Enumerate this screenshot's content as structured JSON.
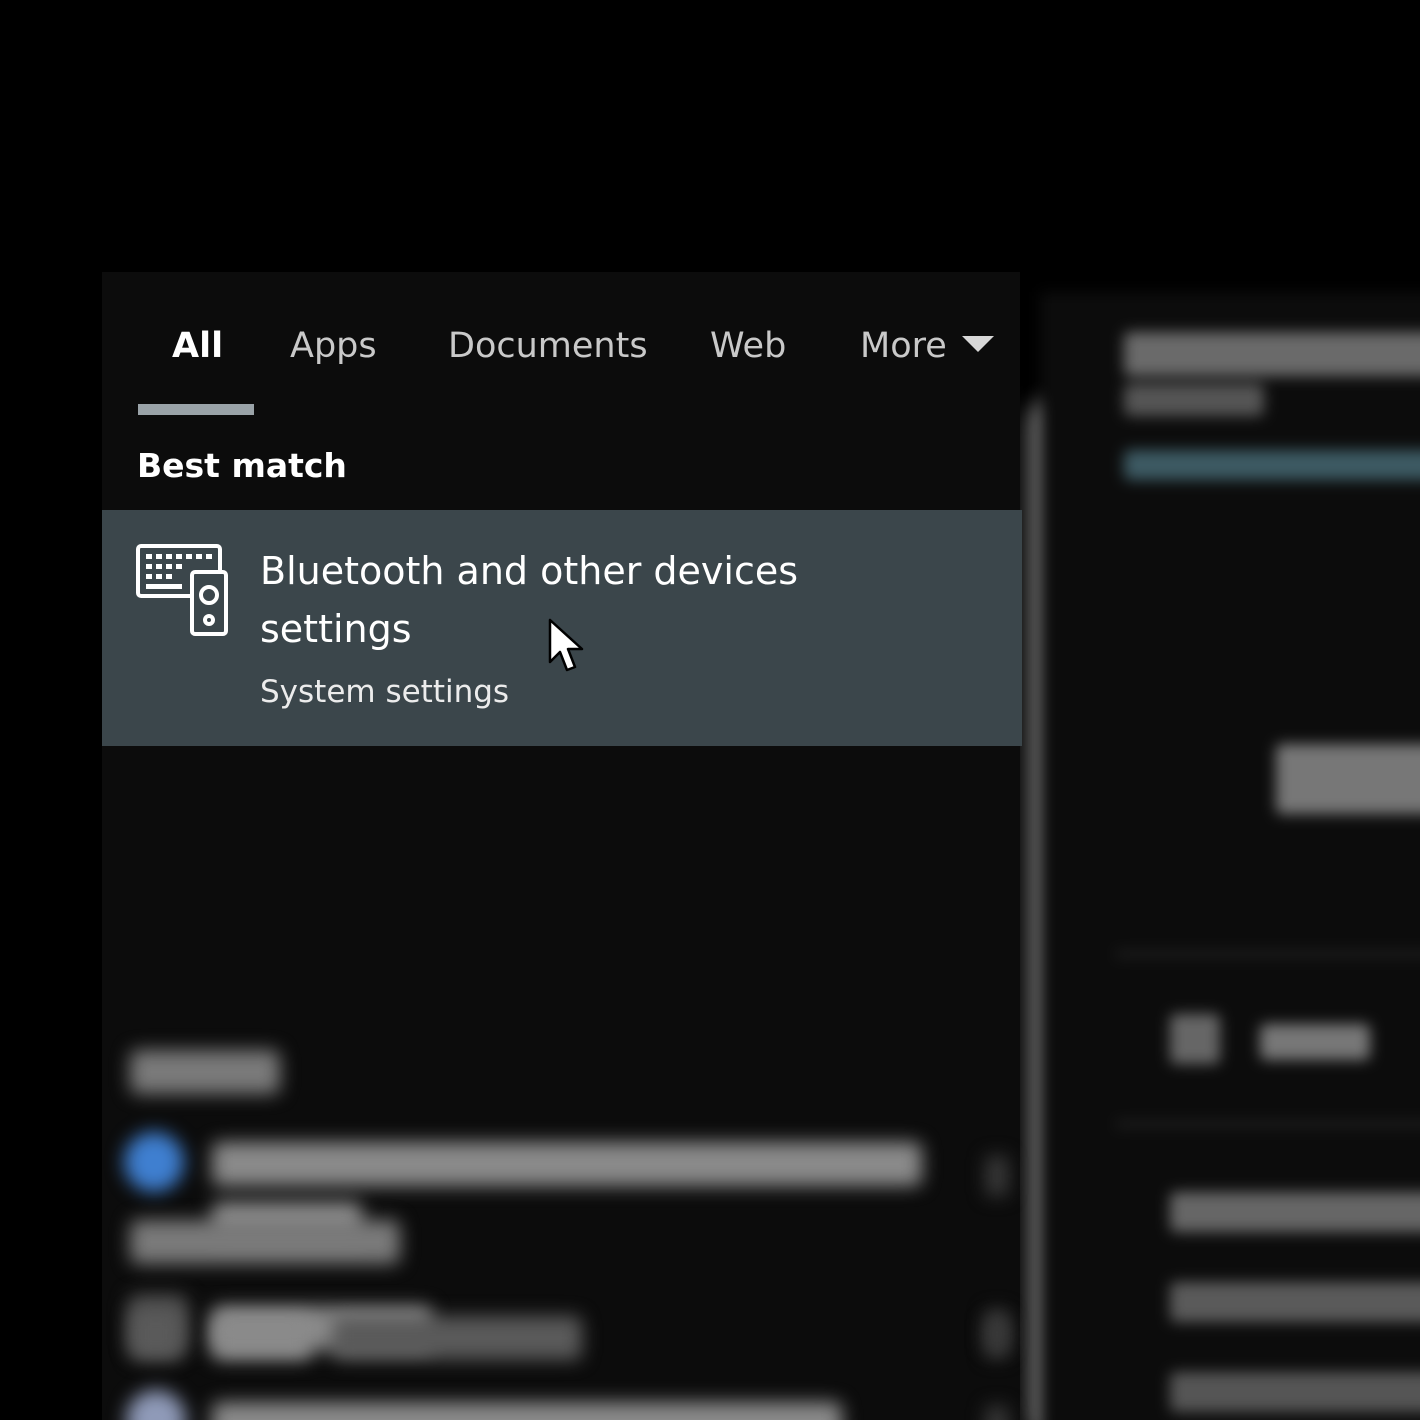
{
  "search_panel": {
    "tabs": [
      {
        "label": "All",
        "active": true
      },
      {
        "label": "Apps",
        "active": false
      },
      {
        "label": "Documents",
        "active": false
      },
      {
        "label": "Web",
        "active": false
      },
      {
        "label": "More",
        "active": false
      }
    ],
    "best_match_heading": "Best match",
    "best_match": {
      "title": "Bluetooth and other devices settings",
      "subtitle": "System settings",
      "icon": "devices-keyboard-speaker-icon"
    }
  },
  "colors": {
    "background": "#000000",
    "panel": "#0c0c0c",
    "selected_result": "#3b464b",
    "tab_underline": "#9aa3a8",
    "text_primary": "#ffffff",
    "text_secondary": "#c9c9c9"
  },
  "cursor": "arrow-cursor-icon"
}
